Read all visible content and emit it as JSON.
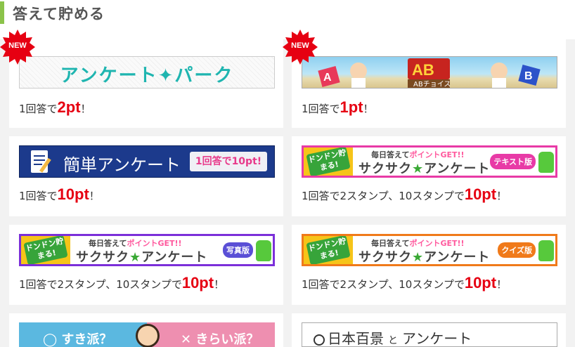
{
  "section": {
    "title": "答えて貯める"
  },
  "new_badge": "NEW",
  "colors": {
    "accent_bar": "#8bc34a",
    "pt_red": "#e60012",
    "grid_bg": "#f2f2f2"
  },
  "cards": [
    {
      "banner": "アンケート✦パーク",
      "reward_prefix": "1回答で",
      "reward_pt": "2pt",
      "reward_suffix": "！"
    },
    {
      "banner": "ABチョイス",
      "reward_prefix": "1回答で",
      "reward_pt": "1pt",
      "reward_suffix": "！"
    },
    {
      "banner": "簡単アンケート",
      "banner_tag": "1回答で10pt!",
      "reward_prefix": "1回答で",
      "reward_pt": "10pt",
      "reward_suffix": "！"
    },
    {
      "banner_badge": "ドンドン貯まる!",
      "banner_line1_a": "毎日答えて",
      "banner_line1_b": "ポイントGET!!",
      "banner_line2_a": "サクサク",
      "banner_line2_star": "★",
      "banner_line2_b": "アンケート",
      "banner_label": "テキスト版",
      "reward_prefix": "1回答で2スタンプ、10スタンプで",
      "reward_pt": "10pt",
      "reward_suffix": "！"
    },
    {
      "banner_badge": "ドンドン貯まる!",
      "banner_line1_a": "毎日答えて",
      "banner_line1_b": "ポイントGET!!",
      "banner_line2_a": "サクサク",
      "banner_line2_star": "★",
      "banner_line2_b": "アンケート",
      "banner_label": "写真版",
      "reward_prefix": "1回答で2スタンプ、10スタンプで",
      "reward_pt": "10pt",
      "reward_suffix": "！"
    },
    {
      "banner_badge": "ドンドン貯まる!",
      "banner_line1_a": "毎日答えて",
      "banner_line1_b": "ポイントGET!!",
      "banner_line2_a": "サクサク",
      "banner_line2_star": "★",
      "banner_line2_b": "アンケート",
      "banner_label": "クイズ版",
      "reward_prefix": "1回答で2スタンプ、10スタンプで",
      "reward_pt": "10pt",
      "reward_suffix": "！"
    },
    {
      "banner_left": "すき派？",
      "banner_right": "きらい派？"
    },
    {
      "banner_a": "日本百景",
      "banner_b": "と",
      "banner_c": "アンケート"
    }
  ]
}
